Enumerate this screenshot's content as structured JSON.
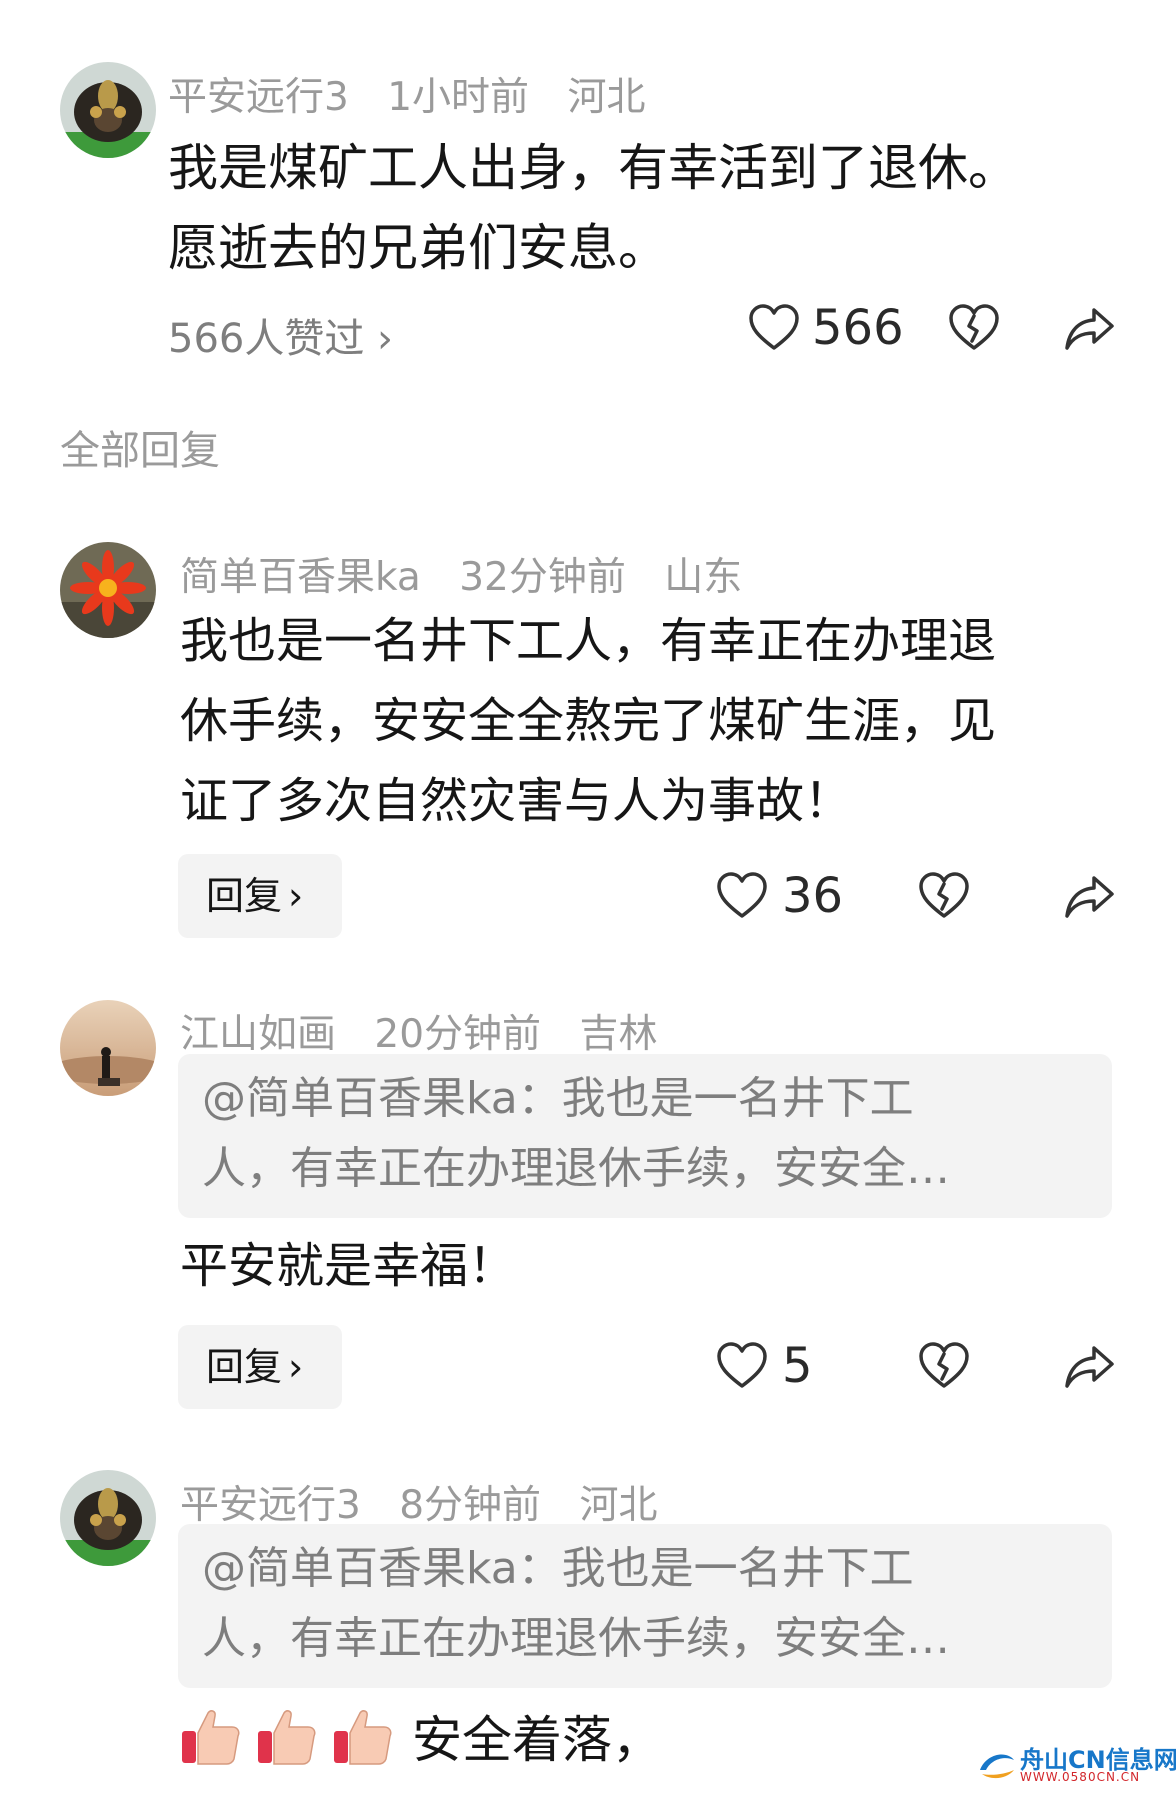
{
  "comment_main": {
    "user": "平安远行3",
    "time": "1小时前",
    "location": "河北",
    "text_line1": "我是煤矿工人出身，有幸活到了退休。",
    "text_line2": "愿逝去的兄弟们安息。",
    "liked_by": "566人赞过 ›",
    "likes": "566"
  },
  "section_title": "全部回复",
  "replies": [
    {
      "user": "简单百香果ka",
      "time": "32分钟前",
      "location": "山东",
      "text_line1": "我也是一名井下工人，有幸正在办理退",
      "text_line2": "休手续，安安全全熬完了煤矿生涯，见",
      "text_line3": "证了多次自然灾害与人为事故！",
      "reply_label": "回复",
      "likes": "36"
    },
    {
      "user": "江山如画",
      "time": "20分钟前",
      "location": "吉林",
      "quote_line1": "@简单百香果ka：我也是一名井下工",
      "quote_line2": "人，有幸正在办理退休手续，安安全…",
      "text": "平安就是幸福！",
      "reply_label": "回复",
      "likes": "5"
    },
    {
      "user": "平安远行3",
      "time": "8分钟前",
      "location": "河北",
      "quote_line1": "@简单百香果ka：我也是一名井下工",
      "quote_line2": "人，有幸正在办理退休手续，安安全…",
      "text": "安全着落，"
    }
  ],
  "watermark": {
    "main": "舟山CN信息网",
    "sub": "WWW.0580CN.CN"
  },
  "icons": {
    "like": "heart-outline-icon",
    "dislike": "broken-heart-icon",
    "share": "share-arrow-icon",
    "emoji": "thumbs-up-emoji-icon"
  },
  "colors": {
    "meta_text": "#9a9a9a",
    "body_text": "#161616",
    "quote_bg": "#f3f3f3",
    "watermark_blue": "#1777c9",
    "watermark_red": "#d2262b"
  }
}
